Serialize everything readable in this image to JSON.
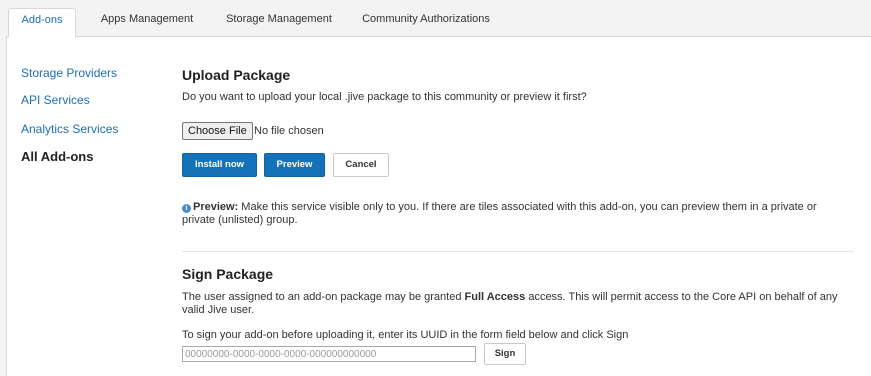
{
  "tabs": [
    {
      "label": "Add-ons",
      "active": true
    },
    {
      "label": "Apps Management",
      "active": false
    },
    {
      "label": "Storage Management",
      "active": false
    },
    {
      "label": "Community Authorizations",
      "active": false
    }
  ],
  "sidebar": {
    "items": [
      {
        "label": "Storage Providers"
      },
      {
        "label": "API Services"
      },
      {
        "label": "Analytics Services"
      },
      {
        "label": "All Add-ons",
        "current": true
      }
    ]
  },
  "upload": {
    "title": "Upload Package",
    "question": "Do you want to upload your local .jive package to this community or preview it first?",
    "choose_file_label": "Choose File",
    "file_status": "No file chosen",
    "install_label": "Install now",
    "preview_label": "Preview",
    "cancel_label": "Cancel",
    "preview_note_bold": "Preview:",
    "preview_note_line1": " Make this service visible only to you. If there are tiles associated with this add-on, you can preview them in a private or",
    "preview_note_line2": "private (unlisted) group."
  },
  "sign": {
    "title": "Sign Package",
    "line1_a": "The user assigned to an add-on package may be granted ",
    "line1_bold": "Full Access",
    "line1_b": " access. This will permit access to the Core API on behalf of any",
    "line2": "valid Jive user.",
    "instruction": "To sign your add-on before uploading it, enter its UUID in the form field below and click Sign",
    "uuid_placeholder": "00000000-0000-0000-0000-000000000000",
    "sign_label": "Sign"
  },
  "colors": {
    "primary": "#1473b8",
    "link": "#1f6fb2"
  }
}
